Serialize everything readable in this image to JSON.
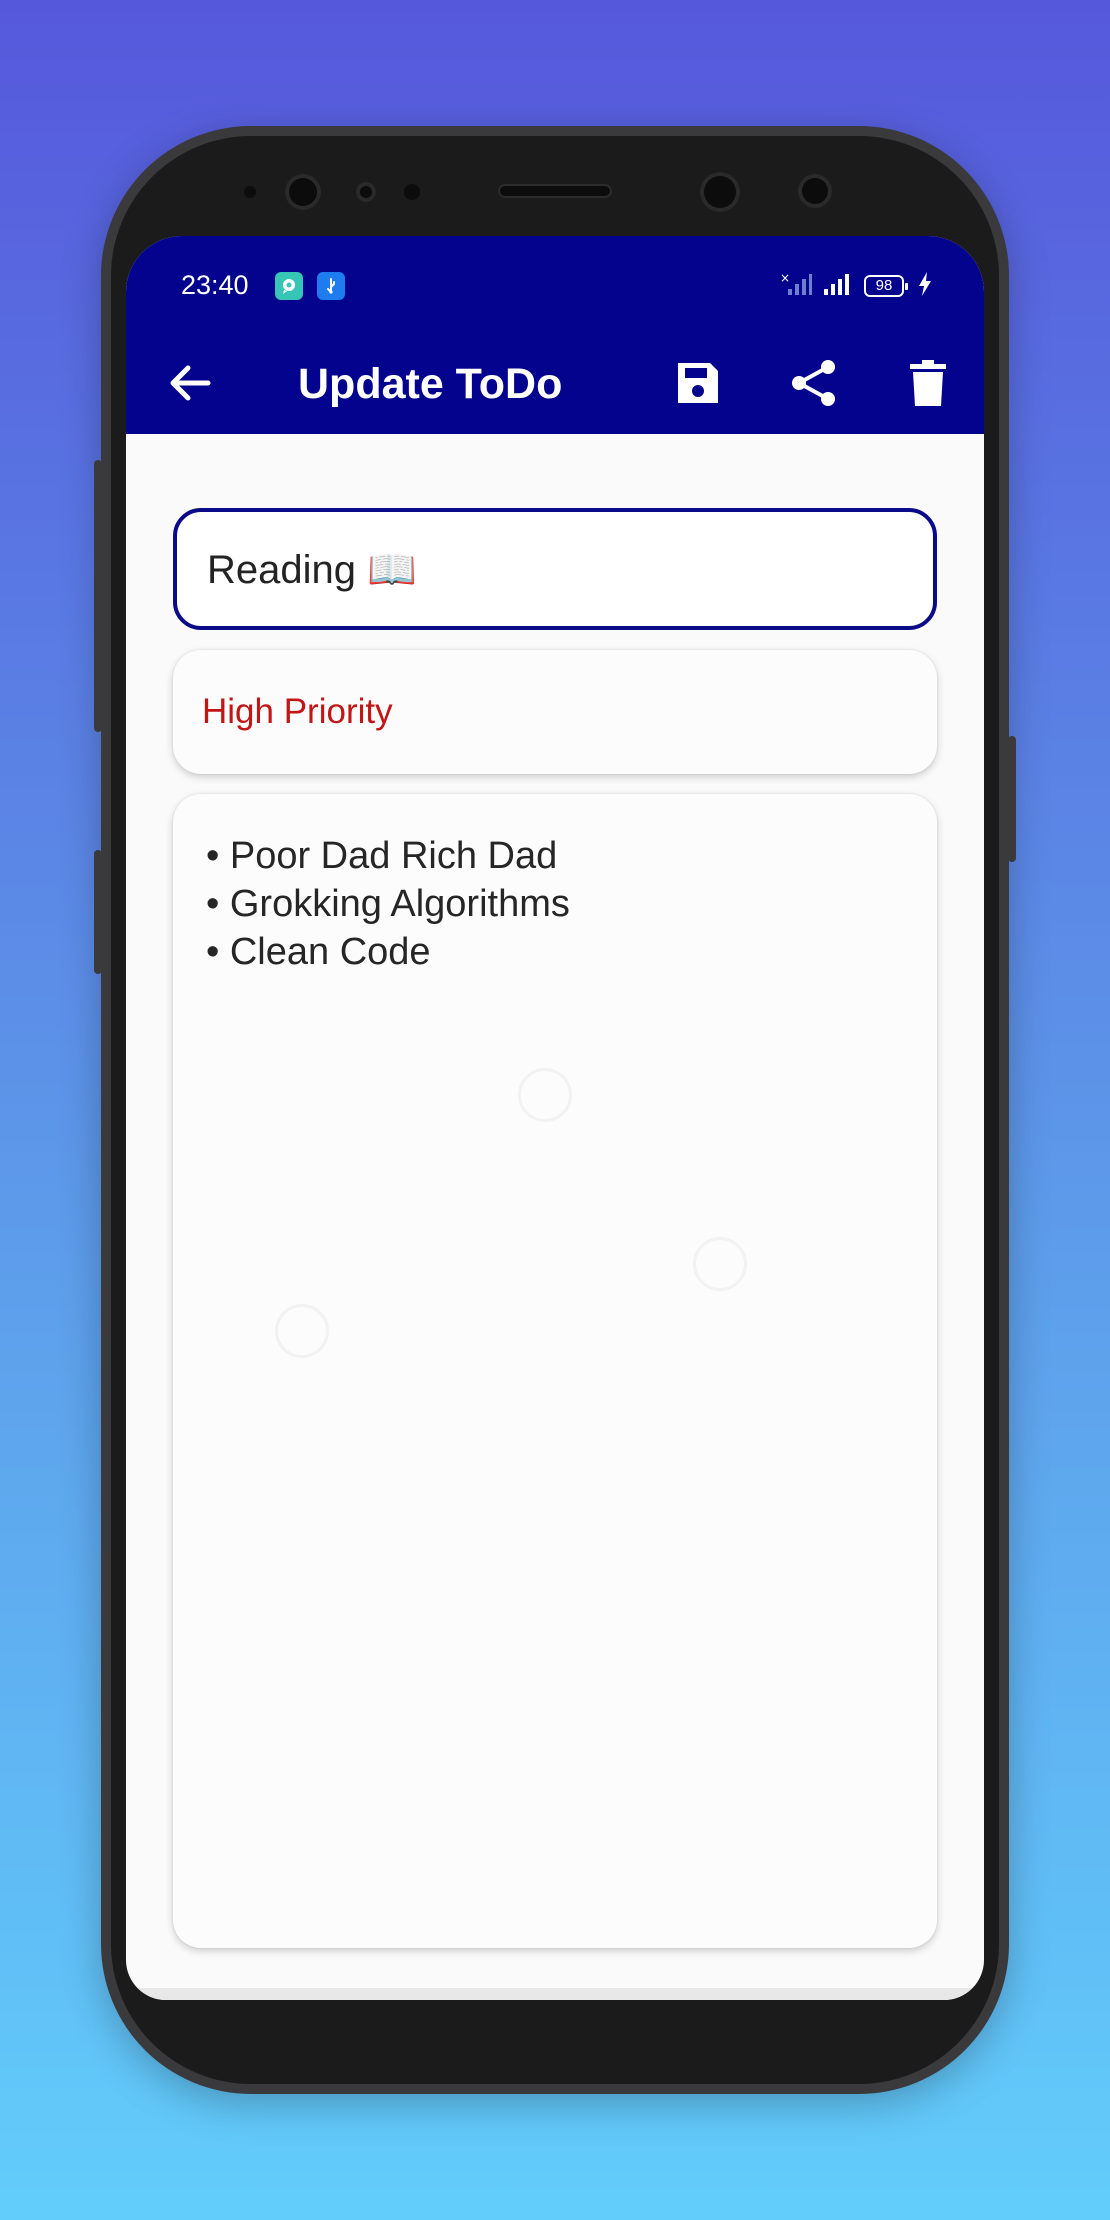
{
  "status_bar": {
    "time": "23:40",
    "battery": "98",
    "icons": [
      "chat-bubble-icon",
      "usb-icon",
      "signal-off-icon",
      "signal-icon",
      "battery-icon",
      "charging-icon"
    ]
  },
  "app_bar": {
    "title": "Update ToDo",
    "icons": [
      "back-arrow-icon",
      "save-icon",
      "share-icon",
      "delete-icon"
    ]
  },
  "form": {
    "title_value": "Reading 📖",
    "priority_value": "High Priority",
    "notes": [
      "• Poor Dad Rich Dad",
      "• Grokking Algorithms",
      "• Clean Code"
    ]
  },
  "colors": {
    "app_bar": "#04038e",
    "priority_text": "#c21515",
    "input_border": "#0b0b8a",
    "background_top": "#5658dc",
    "background_bottom": "#62cdfb"
  }
}
